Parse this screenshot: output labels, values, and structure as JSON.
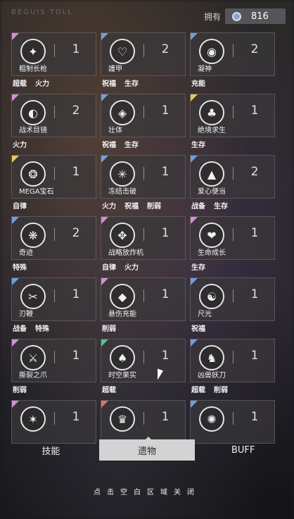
{
  "header": {
    "top_text": "BEGUIS TOLL",
    "currency_label": "拥有",
    "currency_amount": "816"
  },
  "items": [
    {
      "name": "粗制长枪",
      "count": "1",
      "tags": [
        "超载",
        "火力"
      ],
      "corner": "#d48fd4",
      "icon": "spear-icon",
      "glyph": "✦"
    },
    {
      "name": "護甲",
      "count": "2",
      "tags": [
        "祝福",
        "生存"
      ],
      "corner": "#6fa0e0",
      "icon": "shield-icon",
      "glyph": "♡"
    },
    {
      "name": "凝神",
      "count": "2",
      "tags": [
        "充能"
      ],
      "corner": "#6fa0e0",
      "icon": "eye-icon",
      "glyph": "◉"
    },
    {
      "name": "战术目镜",
      "count": "2",
      "tags": [
        "火力"
      ],
      "corner": "#d48fd4",
      "icon": "goggles-icon",
      "glyph": "◐"
    },
    {
      "name": "壮体",
      "count": "1",
      "tags": [
        "祝福",
        "生存"
      ],
      "corner": "#6fa0e0",
      "icon": "body-icon",
      "glyph": "◈"
    },
    {
      "name": "绝境求生",
      "count": "1",
      "tags": [
        "生存"
      ],
      "corner": "#e8c85a",
      "icon": "chest-icon",
      "glyph": "♣"
    },
    {
      "name": "MEGA宝石",
      "count": "1",
      "tags": [
        "自律"
      ],
      "corner": "#e8c85a",
      "icon": "gem-icon",
      "glyph": "❂"
    },
    {
      "name": "冻结击破",
      "count": "1",
      "tags": [
        "火力",
        "祝福",
        "削弱"
      ],
      "corner": "#6fa0e0",
      "icon": "freeze-icon",
      "glyph": "✳"
    },
    {
      "name": "爱心便当",
      "count": "2",
      "tags": [
        "战备",
        "生存"
      ],
      "corner": "#6fa0e0",
      "icon": "lunchbox-icon",
      "glyph": "▲"
    },
    {
      "name": "奇迹",
      "count": "2",
      "tags": [
        "特殊"
      ],
      "corner": "#6fa0e0",
      "icon": "miracle-icon",
      "glyph": "❋"
    },
    {
      "name": "战略放炸机",
      "count": "1",
      "tags": [
        "自律",
        "火力"
      ],
      "corner": "#d48fd4",
      "icon": "bomber-icon",
      "glyph": "✥"
    },
    {
      "name": "生命成长",
      "count": "1",
      "tags": [
        "生存"
      ],
      "corner": "#d48fd4",
      "icon": "heart-icon",
      "glyph": "❤"
    },
    {
      "name": "刃鞭",
      "count": "1",
      "tags": [
        "战备",
        "特殊"
      ],
      "corner": "#6fa0e0",
      "icon": "blade-icon",
      "glyph": "✂"
    },
    {
      "name": "悬伤充能",
      "count": "1",
      "tags": [
        "削弱"
      ],
      "corner": "#d48fd4",
      "icon": "charge-icon",
      "glyph": "◆"
    },
    {
      "name": "尺光",
      "count": "1",
      "tags": [
        "祝福"
      ],
      "corner": "#6fa0e0",
      "icon": "light-icon",
      "glyph": "☯"
    },
    {
      "name": "撕裂之爪",
      "count": "1",
      "tags": [
        "削弱"
      ],
      "corner": "#d48fd4",
      "icon": "claw-icon",
      "glyph": "⚔"
    },
    {
      "name": "时空果实",
      "count": "1",
      "tags": [
        "超载"
      ],
      "corner": "#4fc48f",
      "icon": "fruit-icon",
      "glyph": "♠"
    },
    {
      "name": "凶兽妖刀",
      "count": "1",
      "tags": [
        "超载",
        "削弱"
      ],
      "corner": "#6fa0e0",
      "icon": "beast-icon",
      "glyph": "♞"
    },
    {
      "name": "",
      "count": "1",
      "tags": [],
      "corner": "#d48fd4",
      "icon": "emblem-icon",
      "glyph": "✶"
    },
    {
      "name": "",
      "count": "1",
      "tags": [],
      "corner": "#e07070",
      "icon": "crown-icon",
      "glyph": "♛"
    },
    {
      "name": "",
      "count": "1",
      "tags": [],
      "corner": "#6fa0e0",
      "icon": "spiral-icon",
      "glyph": "✺"
    }
  ],
  "tabs": [
    {
      "label": "技能",
      "active": false
    },
    {
      "label": "遗物",
      "active": true
    },
    {
      "label": "BUFF",
      "active": false
    }
  ],
  "footer": {
    "close_hint": "点击空白区域关闭"
  }
}
